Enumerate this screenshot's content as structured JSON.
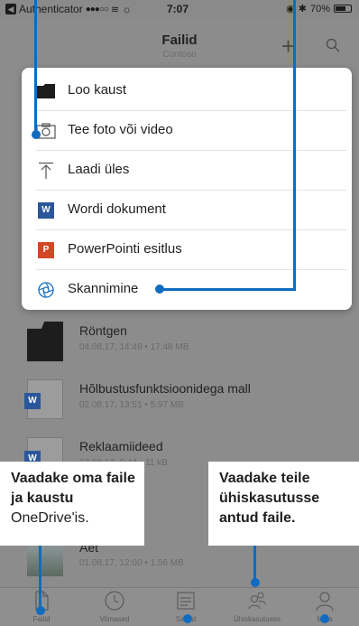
{
  "status_bar": {
    "carrier": "Authenticator",
    "signal": "●●●○○",
    "time": "7:07",
    "battery": "70%"
  },
  "header": {
    "title": "Failid",
    "subtitle": "Contoso"
  },
  "menu": {
    "items": [
      {
        "label": "Loo kaust",
        "icon": "folder-icon"
      },
      {
        "label": "Tee foto või video",
        "icon": "camera-icon"
      },
      {
        "label": "Laadi üles",
        "icon": "upload-icon"
      },
      {
        "label": "Wordi dokument",
        "icon": "word-icon"
      },
      {
        "label": "PowerPointi esitlus",
        "icon": "powerpoint-icon"
      },
      {
        "label": "Skannimine",
        "icon": "scan-icon"
      }
    ]
  },
  "files": [
    {
      "name": "Röntgen",
      "meta": "04.08.17, 14:49 • 17.48 MB",
      "type": "folder"
    },
    {
      "name": "Hõlbustusfunktsioonidega mall",
      "meta": "02.08.17, 13:51 • 5.97 MB",
      "type": "word"
    },
    {
      "name": "Reklaamiideed",
      "meta": "07.08.12, 9:44 • 11 kB",
      "type": "word"
    },
    {
      "name": "Aet",
      "meta": "01.08.17, 12:00 • 1.56 MB",
      "type": "photo"
    }
  ],
  "tabs": [
    {
      "label": "Failid"
    },
    {
      "label": "Viimased"
    },
    {
      "label": "Saidid"
    },
    {
      "label": "Ühiskasutuses"
    },
    {
      "label": "Mina"
    }
  ],
  "callouts": {
    "left_bold": "Vaadake oma faile ja kaustu",
    "left_plain": "OneDrive'is.",
    "right_bold": "Vaadake teile ühiskasutusse antud faile."
  },
  "colors": {
    "accent": "#0f6cc0",
    "word": "#2b579a",
    "powerpoint": "#d24726"
  }
}
